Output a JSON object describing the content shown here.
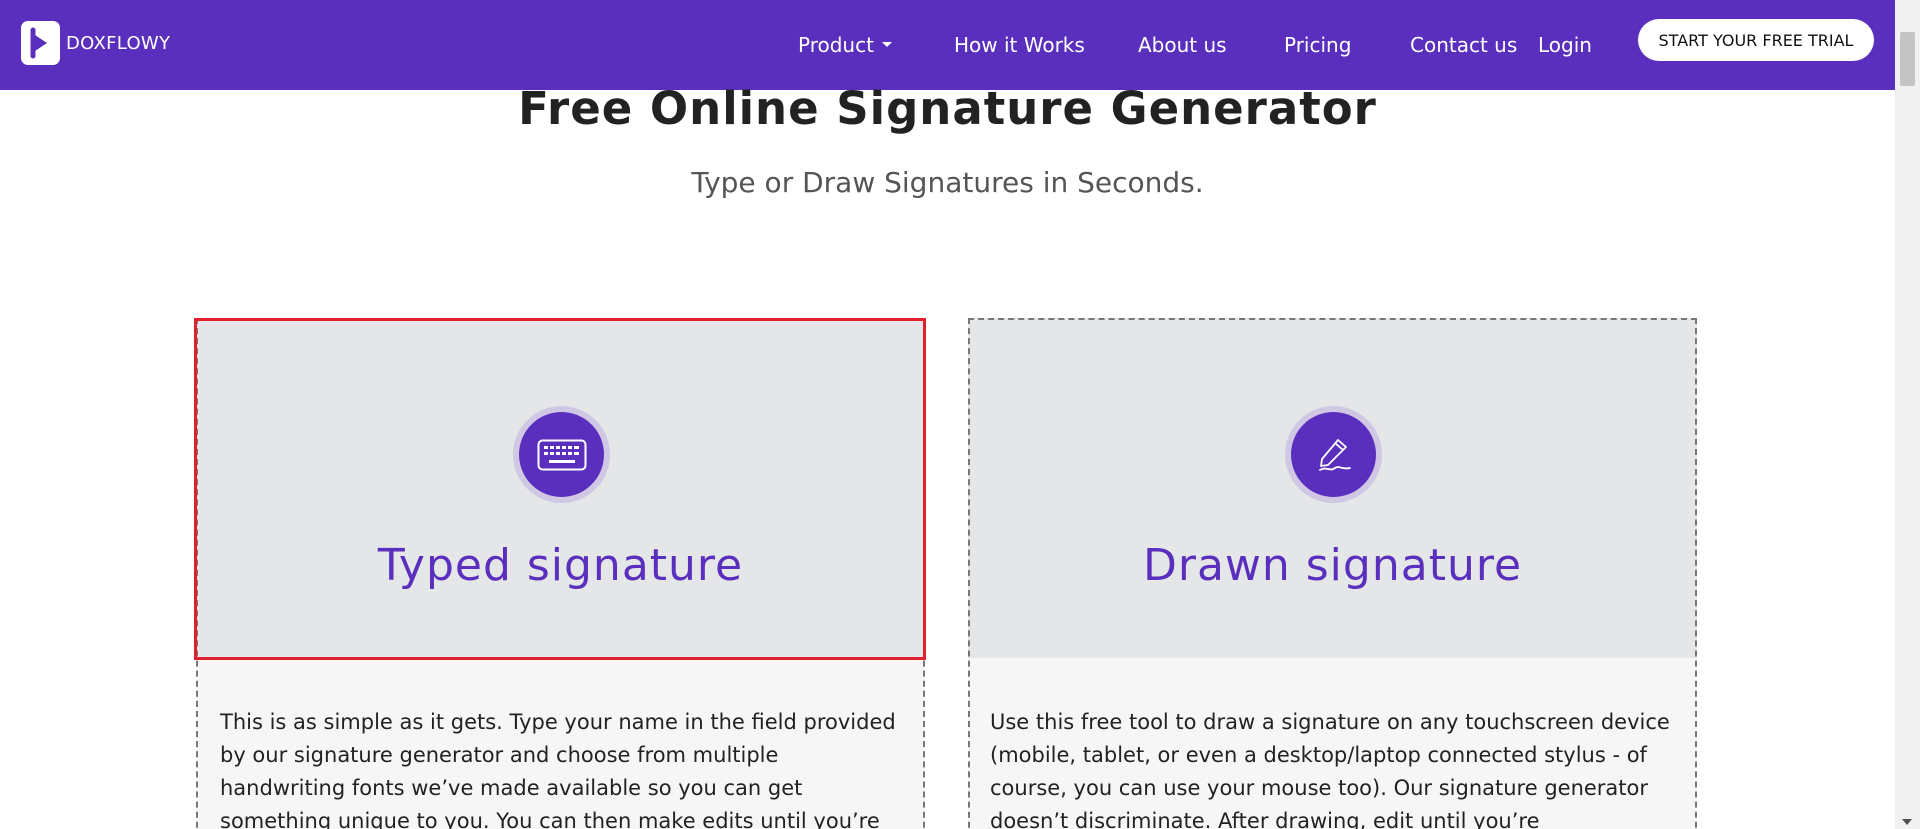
{
  "brand": {
    "name": "DOXFLOWY",
    "colors": {
      "primary": "#5a2fbd",
      "card_bg": "#e4e6e7",
      "selection": "#e0202c"
    }
  },
  "nav": {
    "items": [
      {
        "label": "Product",
        "has_dropdown": true
      },
      {
        "label": "How it Works"
      },
      {
        "label": "About us"
      },
      {
        "label": "Pricing"
      },
      {
        "label": "Contact us"
      },
      {
        "label": "Login"
      }
    ],
    "cta_label": "START YOUR FREE TRIAL"
  },
  "hero": {
    "title": "Free Online Signature Generator",
    "subtitle": "Type or Draw Signatures in Seconds."
  },
  "cards": [
    {
      "icon": "keyboard-icon",
      "title": "Typed signature",
      "selected": true,
      "description": "This is as simple as it gets. Type your name in the field provided by our signature generator and choose from multiple handwriting fonts we’ve made available so you can get something unique to you. You can then make edits until you’re"
    },
    {
      "icon": "pen-signature-icon",
      "title": "Drawn signature",
      "selected": false,
      "description": "Use this free tool to draw a signature on any touchscreen device (mobile, tablet, or even a desktop/laptop connected stylus - of course, you can use your mouse too). Our signature generator doesn’t discriminate. After drawing, edit until you’re"
    }
  ]
}
